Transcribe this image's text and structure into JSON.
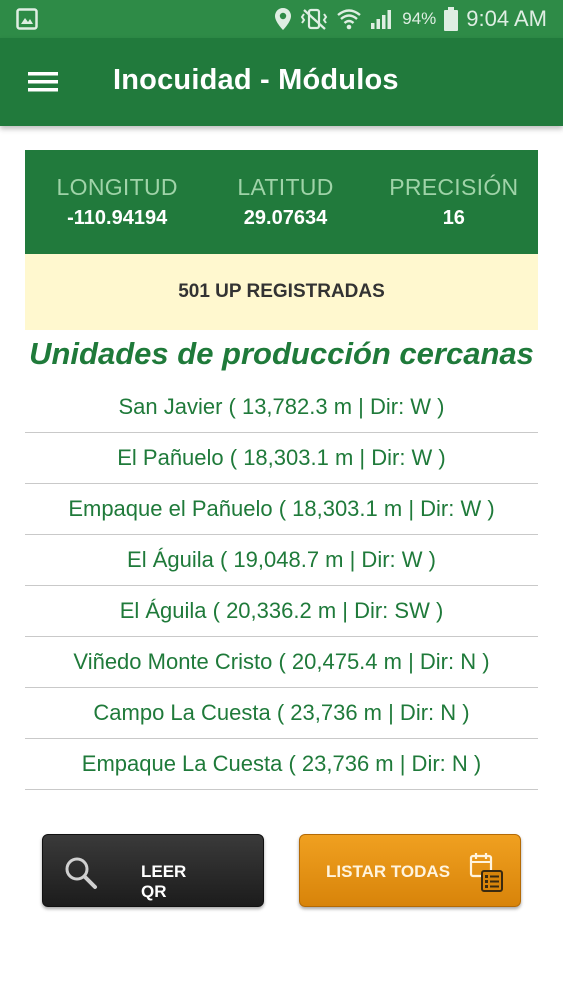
{
  "status_bar": {
    "battery": "94%",
    "time": "9:04 AM",
    "icons": [
      "image-icon",
      "location-pin-icon",
      "vibrate-mute-icon",
      "wifi-icon",
      "signal-icon",
      "battery-icon"
    ]
  },
  "app_bar": {
    "title": "Inocuidad - Módulos",
    "menu_icon": "hamburger-menu-icon"
  },
  "coordinates": {
    "longitude_label": "LONGITUD",
    "longitude_value": "-110.94194",
    "latitude_label": "LATITUD",
    "latitude_value": "29.07634",
    "precision_label": "PRECISIÓN",
    "precision_value": "16"
  },
  "registered": "501 UP REGISTRADAS",
  "section_title": "Unidades de producción cercanas",
  "nearby_units": [
    "San Javier ( 13,782.3 m | Dir: W )",
    "El Pañuelo ( 18,303.1 m | Dir: W )",
    "Empaque el Pañuelo ( 18,303.1 m | Dir: W )",
    "El Águila ( 19,048.7 m | Dir: W )",
    "El Águila ( 20,336.2 m | Dir: SW )",
    "Viñedo Monte Cristo ( 20,475.4 m | Dir: N )",
    "Campo La Cuesta ( 23,736 m | Dir: N )",
    "Empaque La Cuesta ( 23,736 m | Dir: N )"
  ],
  "buttons": {
    "read_qr": "LEER QR",
    "list_all": "LISTAR TODAS"
  },
  "colors": {
    "status_bar": "#2e8b47",
    "app_bar": "#217a3c",
    "accent_text": "#1f7a3a",
    "banner_bg": "#fff8cf",
    "qr_button": "#2a2a2a",
    "list_button": "#e6920f"
  }
}
